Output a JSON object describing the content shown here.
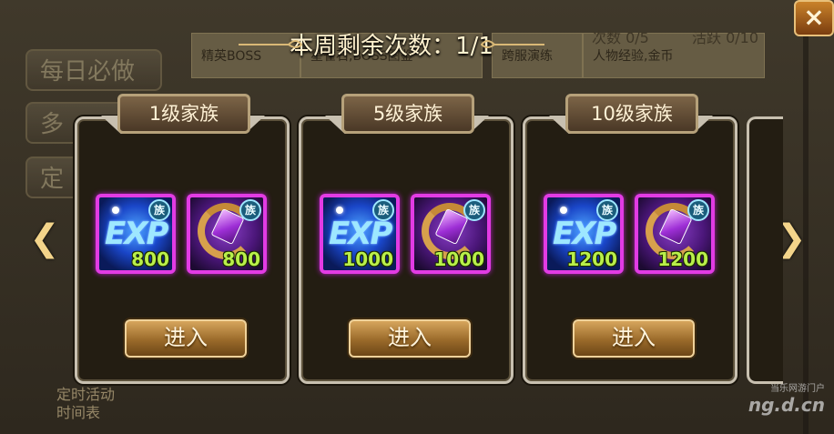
{
  "background": {
    "side_buttons": [
      "每日必做",
      "多",
      "定"
    ],
    "strips": [
      "精英BOSS",
      "星雀石,BOSS图鉴",
      "跨服演练",
      "人物经验,金币"
    ],
    "top_counts": [
      "次数 0/5",
      "活跃 0/10"
    ],
    "bottom_text": "定时活动\n时间表",
    "watermark": "ng.d.cn",
    "watermark_sub": "当乐网游门户"
  },
  "header": {
    "title": "本周剩余次数：1/1"
  },
  "cards": [
    {
      "title": "1级家族",
      "rewards": [
        {
          "icon": "exp-orb-icon",
          "count": "800"
        },
        {
          "icon": "moon-gem-icon",
          "count": "800"
        }
      ],
      "button": "进入"
    },
    {
      "title": "5级家族",
      "rewards": [
        {
          "icon": "exp-orb-icon",
          "count": "1000"
        },
        {
          "icon": "moon-gem-icon",
          "count": "1000"
        }
      ],
      "button": "进入"
    },
    {
      "title": "10级家族",
      "rewards": [
        {
          "icon": "exp-orb-icon",
          "count": "1200"
        },
        {
          "icon": "moon-gem-icon",
          "count": "1200"
        }
      ],
      "button": "进入"
    }
  ],
  "badge_text": "族",
  "exp_text": "EXP",
  "close_symbol": "×",
  "arrows": {
    "left": "❮",
    "right": "❯"
  }
}
